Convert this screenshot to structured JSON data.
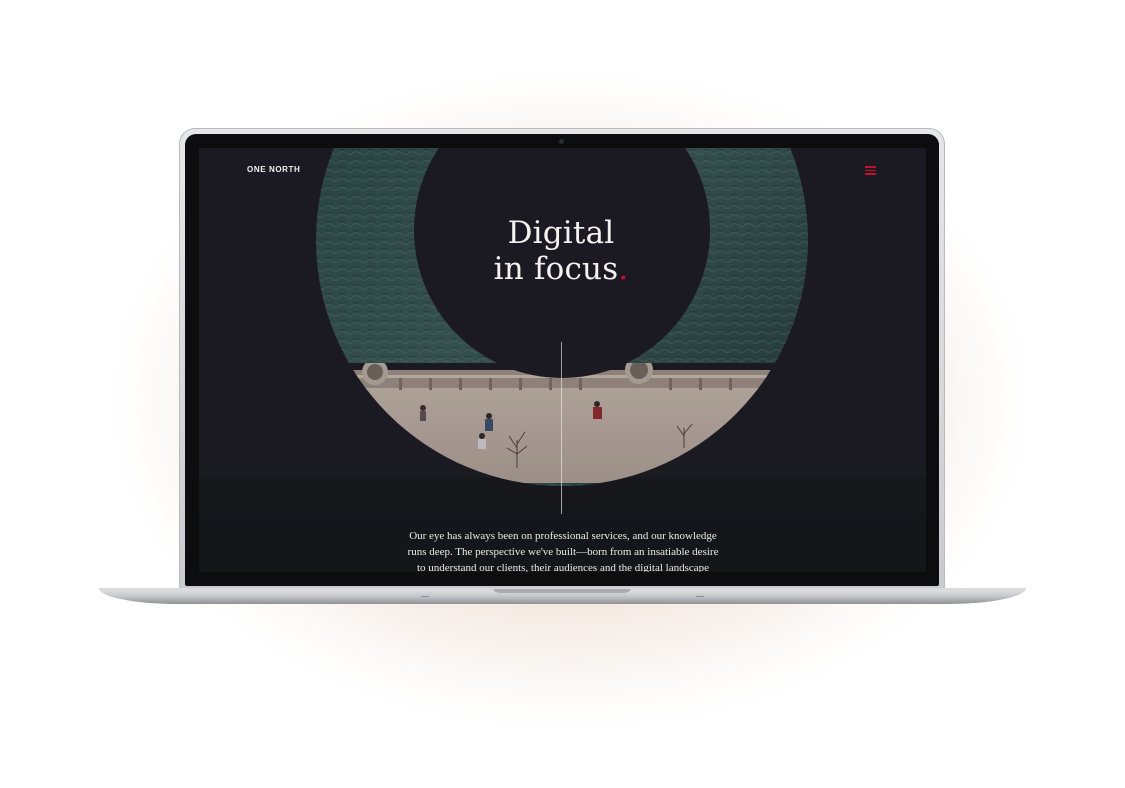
{
  "header": {
    "logo_text": "ONE NORTH",
    "menu_icon": "hamburger-menu-icon"
  },
  "hero": {
    "headline_line1": "Digital",
    "headline_line2": "in focus",
    "headline_dot": "."
  },
  "intro": {
    "line1": "Our eye has always been on professional services, and our knowledge",
    "line2": "runs deep. The perspective we've built—born from an insatiable desire",
    "line3": "to understand our clients, their audiences and the digital landscape"
  },
  "colors": {
    "accent": "#c8102e",
    "background": "#1b1a22",
    "water": "#2f4a4a"
  }
}
